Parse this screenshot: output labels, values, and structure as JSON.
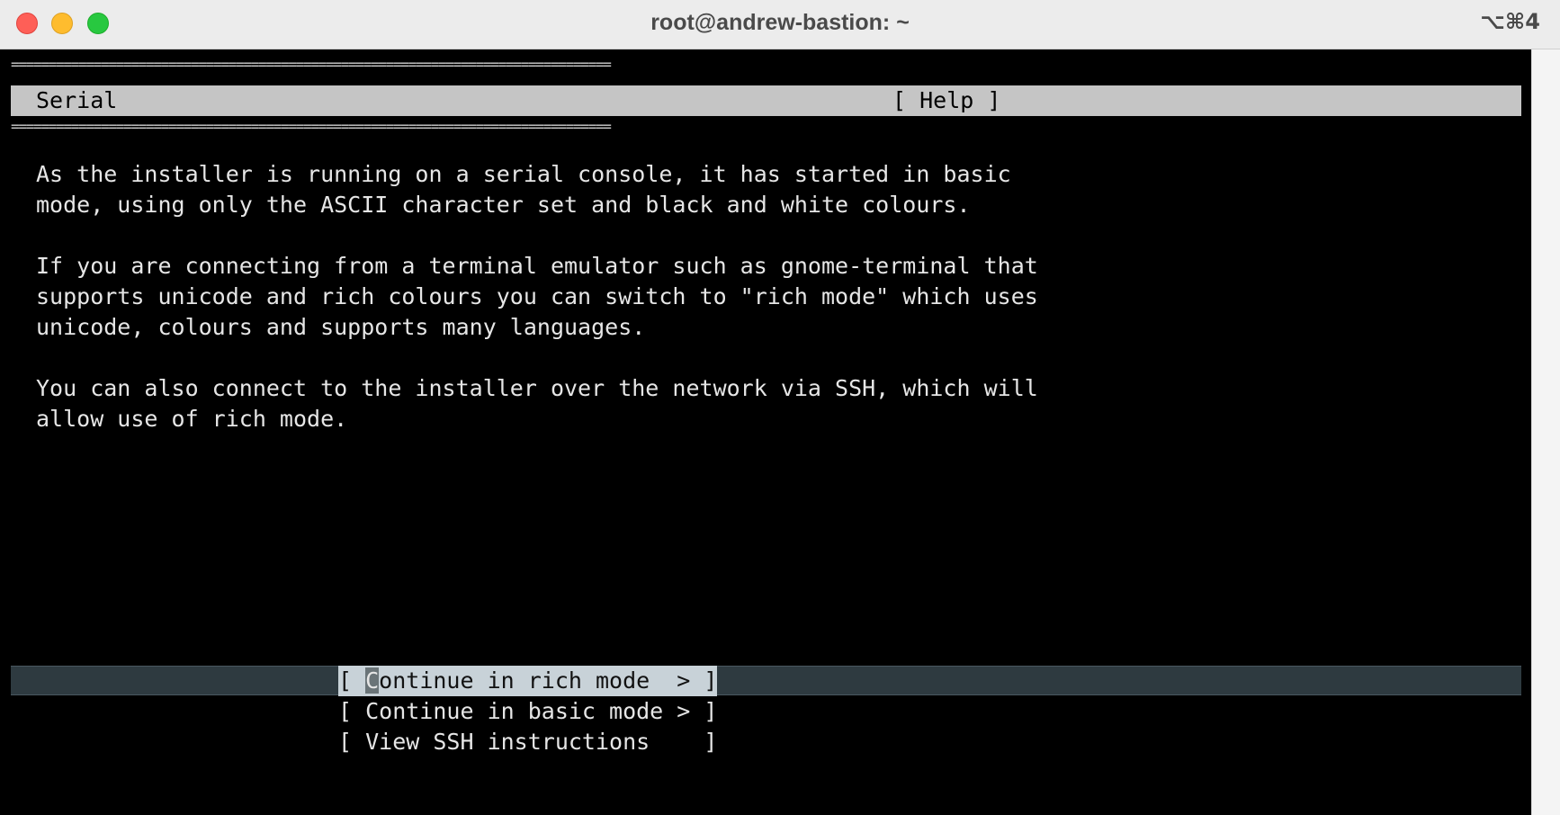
{
  "window": {
    "title": "root@andrew-bastion: ~",
    "shortcut": "⌥⌘4"
  },
  "screen": {
    "rule": "================================================================================",
    "header_title": "Serial",
    "help_label": "[ Help ]",
    "paragraphs": [
      [
        "As the installer is running on a serial console, it has started in basic",
        "mode, using only the ASCII character set and black and white colours."
      ],
      [
        "If you are connecting from a terminal emulator such as gnome-terminal that",
        "supports unicode and rich colours you can switch to \"rich mode\" which uses",
        "unicode, colours and supports many languages."
      ],
      [
        "You can also connect to the installer over the network via SSH, which will",
        "allow use of rich mode."
      ]
    ],
    "options": [
      {
        "open": "[ ",
        "cursor_char": "C",
        "rest": "ontinue in rich mode  > ]",
        "label": "Continue in rich mode  >",
        "selected": true
      },
      {
        "label": "[ Continue in basic mode > ]",
        "selected": false
      },
      {
        "label": "[ View SSH instructions    ]",
        "selected": false
      }
    ]
  },
  "colors": {
    "terminal_bg": "#000000",
    "header_bg": "#c5c5c5",
    "selected_bg": "#c8d2d8",
    "highlight_row_bg": "#2e3a40"
  }
}
